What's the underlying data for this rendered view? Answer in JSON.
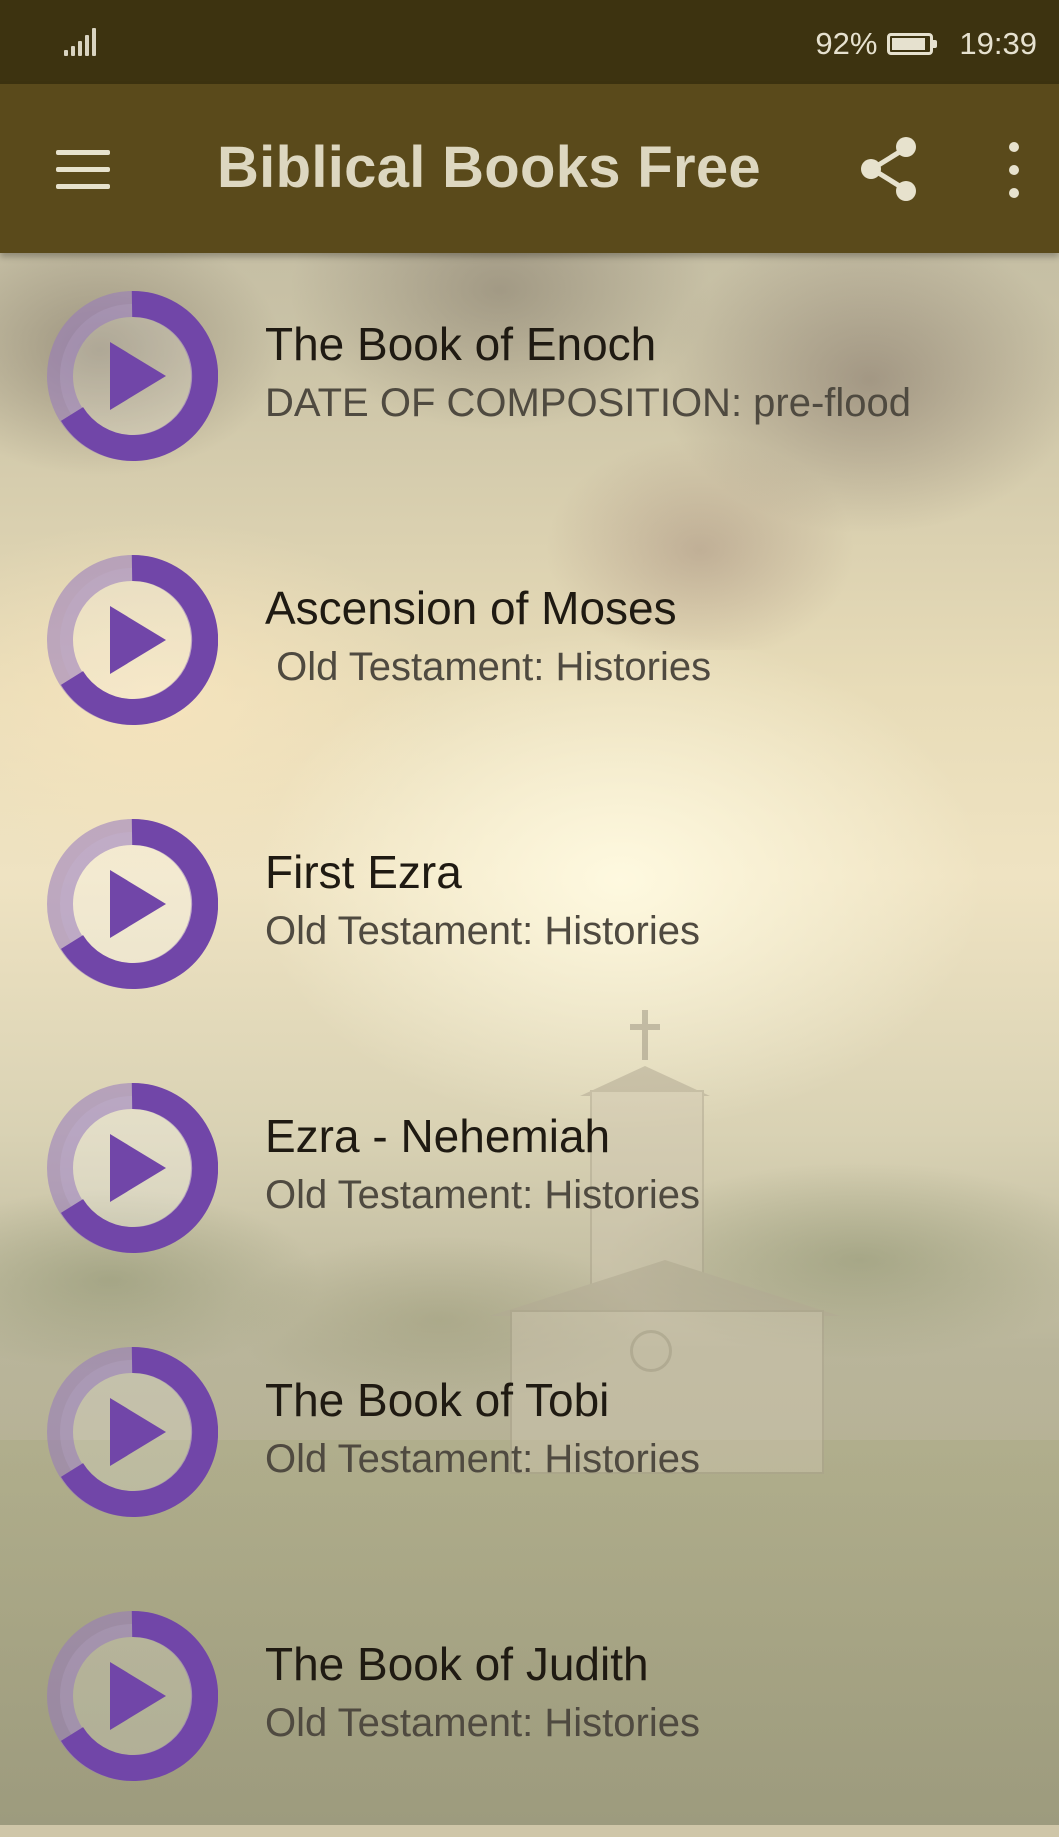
{
  "status_bar": {
    "battery_percent": "92%",
    "time": "19:39",
    "icons": [
      "signal-icon",
      "battery-icon"
    ]
  },
  "app_bar": {
    "title": "Biblical Books Free",
    "icons": [
      "menu-icon",
      "share-icon",
      "more-vert-icon"
    ]
  },
  "colors": {
    "status_bar": "#3d3310",
    "app_bar": "#5a4a1b",
    "accent": "#7a4fb0"
  },
  "books": [
    {
      "title": "The Book of Enoch",
      "subtitle": "DATE OF COMPOSITION: pre-flood",
      "icon": "play-circle-icon"
    },
    {
      "title": "Ascension of Moses",
      "subtitle": " Old Testament: Histories",
      "icon": "play-circle-icon"
    },
    {
      "title": "First Ezra",
      "subtitle": "Old Testament: Histories",
      "icon": "play-circle-icon"
    },
    {
      "title": "Ezra - Nehemiah",
      "subtitle": "Old Testament: Histories",
      "icon": "play-circle-icon"
    },
    {
      "title": "The Book of Tobi",
      "subtitle": "Old Testament: Histories",
      "icon": "play-circle-icon"
    },
    {
      "title": "The Book of Judith",
      "subtitle": "Old Testament: Histories",
      "icon": "play-circle-icon"
    }
  ]
}
